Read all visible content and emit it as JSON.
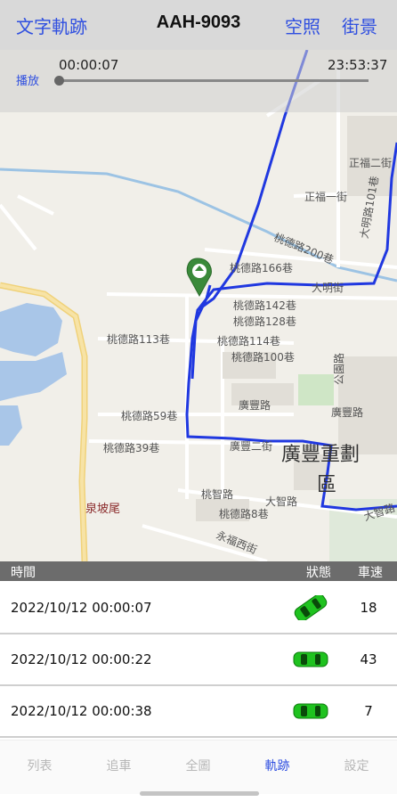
{
  "header": {
    "left_button": "文字軌跡",
    "title": "AAH-9093",
    "satellite_button": "空照",
    "street_button": "街景"
  },
  "playback": {
    "start_time": "00:00:07",
    "end_time": "23:53:37",
    "play_label": "播放",
    "progress": 0.0
  },
  "map": {
    "labels": {
      "r1": "桃德路166巷",
      "r2": "桃德路142巷",
      "r3": "桃德路128巷",
      "r4": "桃德路113巷",
      "r5": "桃德路114巷",
      "r6": "桃德路100巷",
      "r7": "桃德路59巷",
      "r8": "桃德路39巷",
      "r9": "廣豐路",
      "r10": "廣豐路",
      "r11": "廣豐二街",
      "r12": "大智路",
      "r13": "桃智路",
      "r14": "桃德路8巷",
      "r15": "永福西街",
      "r16": "正福一街",
      "r17": "正福二街",
      "r18": "大明街",
      "r19": "大明路101巷",
      "r20": "桃德路200巷",
      "r21": "公園路",
      "r22": "大智路",
      "district": "廣豐重劃",
      "district2": "區",
      "place": "泉坡尾"
    },
    "route_color": "#2038e0"
  },
  "table": {
    "headers": {
      "time": "時間",
      "status": "狀態",
      "speed": "車速"
    },
    "rows": [
      {
        "time": "2022/10/12 00:00:07",
        "speed": "18",
        "car_color": "#1fc21f",
        "car_icon": "car-icon"
      },
      {
        "time": "2022/10/12 00:00:22",
        "speed": "43",
        "car_color": "#1fc21f",
        "car_icon": "car-icon"
      },
      {
        "time": "2022/10/12 00:00:38",
        "speed": "7",
        "car_color": "#1fc21f",
        "car_icon": "car-icon"
      }
    ]
  },
  "tabs": [
    {
      "label": "列表",
      "active": false
    },
    {
      "label": "追車",
      "active": false
    },
    {
      "label": "全圖",
      "active": false
    },
    {
      "label": "軌跡",
      "active": true
    },
    {
      "label": "設定",
      "active": false
    }
  ],
  "colors": {
    "accent": "#2f4fe0",
    "header_bg": "#d9d9d9",
    "table_header_bg": "#6c6c6c"
  }
}
